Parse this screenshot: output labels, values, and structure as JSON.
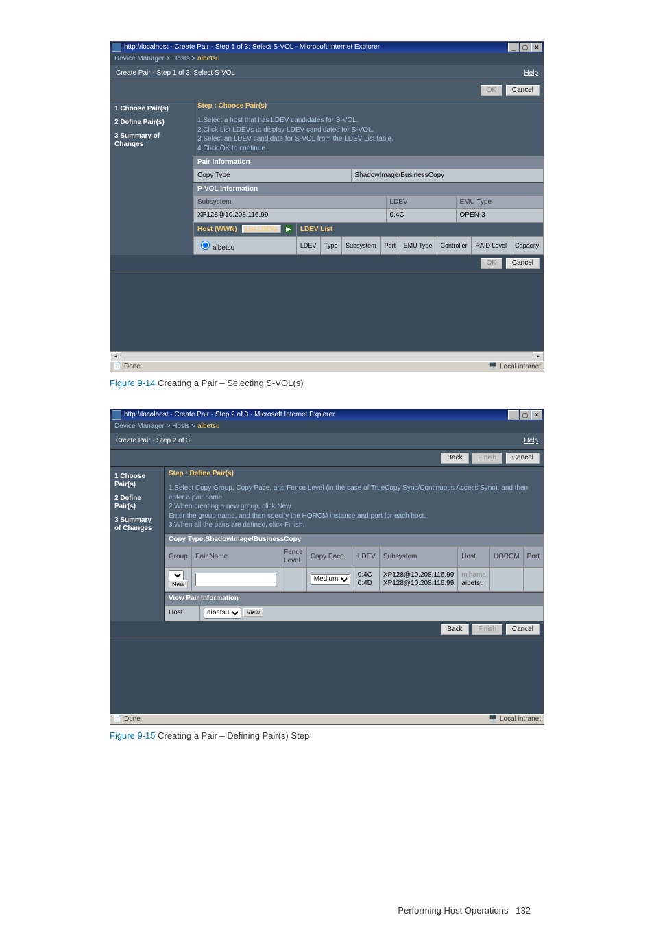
{
  "fig1": {
    "caption_num": "Figure 9-14",
    "caption_text": " Creating a Pair – Selecting S-VOL(s)",
    "title": "http://localhost - Create Pair - Step 1 of 3: Select S-VOL - Microsoft Internet Explorer",
    "breadcrumb_prefix": "Device Manager > Hosts > ",
    "breadcrumb_active": "aibetsu",
    "page_title": "Create Pair - Step 1 of 3: Select S-VOL",
    "help": "Help",
    "ok": "OK",
    "cancel": "Cancel",
    "sidebar": {
      "s1": "1 Choose Pair(s)",
      "s2": "2 Define Pair(s)",
      "s3": "3 Summary of Changes"
    },
    "step_header": "Step : Choose Pair(s)",
    "instr1": "1.Select a host that has LDEV candidates for S-VOL.",
    "instr2": "2.Click List LDEVs to display LDEV candidates for S-VOL.",
    "instr3": "3.Select an LDEV candidate for S-VOL from the LDEV List table.",
    "instr4": "4.Click OK to continue.",
    "pair_info": "Pair Information",
    "copy_type_label": "Copy Type",
    "copy_type_value": "ShadowImage/BusinessCopy",
    "pvol_info": "P-VOL Information",
    "subsystem_h": "Subsystem",
    "ldev_h": "LDEV",
    "emu_h": "EMU Type",
    "subsystem_v": "XP128@10.208.116.99",
    "ldev_v": "0:4C",
    "emu_v": "OPEN-3",
    "host_wwn": "Host (WWN)",
    "list_ldevs": "List LDEVs",
    "ldev_list": "LDEV List",
    "host_value": "aibetsu",
    "col_ldev": "LDEV",
    "col_type": "Type",
    "col_subsystem": "Subsystem",
    "col_port": "Port",
    "col_emu": "EMU Type",
    "col_controller": "Controller",
    "col_raid": "RAID Level",
    "col_capacity": "Capacity",
    "done": "Done",
    "zone": "Local intranet"
  },
  "fig2": {
    "caption_num": "Figure 9-15",
    "caption_text": " Creating a Pair – Defining Pair(s) Step",
    "title": "http://localhost - Create Pair - Step 2 of 3 - Microsoft Internet Explorer",
    "breadcrumb_prefix": "Device Manager > Hosts > ",
    "breadcrumb_active": "aibetsu",
    "page_title": "Create Pair - Step 2 of 3",
    "help": "Help",
    "back": "Back",
    "finish": "Finish",
    "cancel": "Cancel",
    "sidebar": {
      "s1": "1 Choose Pair(s)",
      "s2": "2 Define Pair(s)",
      "s3": "3 Summary of Changes"
    },
    "step_header": "Step : Define Pair(s)",
    "instr1": "1.Select Copy Group, Copy Pace, and Fence Level (in the case of TrueCopy Sync/Continuous Access Sync), and then enter a pair name.",
    "instr2": "2.When creating a new group, click New.",
    "instr2b": "  Enter the group name, and then specify the HORCM instance and port for each host.",
    "instr3": "3.When all the pairs are defined, click Finish.",
    "copy_type_header": "Copy Type:ShadowImage/BusinessCopy",
    "col_group": "Group",
    "col_pairname": "Pair Name",
    "col_fence": "Fence Level",
    "col_pace": "Copy Pace",
    "col_ldev": "LDEV",
    "col_subsystem": "Subsystem",
    "col_host": "Host",
    "col_horcm": "HORCM",
    "col_port": "Port",
    "new": "New",
    "pace_value": "Medium",
    "ldev_a": "0:4C",
    "ldev_b": "0:4D",
    "subsys_a": "XP128@10.208.116.99",
    "subsys_b": "XP128@10.208.116.99",
    "host_a": "mihama",
    "host_b": "aibetsu",
    "view_pair": "View Pair Information",
    "host_label": "Host",
    "host_select": "aibetsu",
    "view": "View",
    "done": "Done",
    "zone": "Local intranet"
  },
  "footer": {
    "text": "Performing Host Operations",
    "page": "132"
  }
}
